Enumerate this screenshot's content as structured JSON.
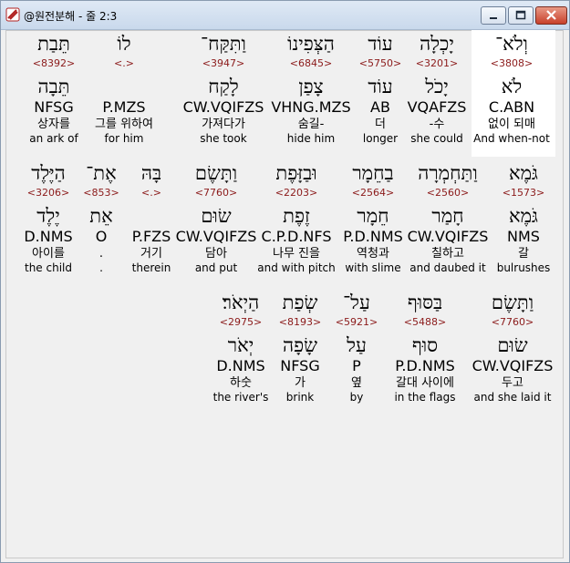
{
  "window": {
    "title": "@원전분해 - 줄 2:3"
  },
  "rows": [
    [
      {
        "heb": "וְלֹא־",
        "num": "<3808>",
        "lemma": "לֹא",
        "parse": "C.ABN",
        "kor": "없이 되매",
        "eng": "And when-not"
      },
      {
        "heb": "יָכְלָה",
        "num": "<3201>",
        "lemma": "יָכֹל",
        "parse": "VQAFZS",
        "kor": "-수",
        "eng": "she could"
      },
      {
        "heb": "עוֹד",
        "num": "<5750>",
        "lemma": "עוֹד",
        "parse": "AB",
        "kor": "더",
        "eng": "longer"
      },
      {
        "heb": "הַצְּפִינוֹ",
        "num": "<6845>",
        "lemma": "צָפַן",
        "parse": "VHNG.MZS",
        "kor": "숨길-",
        "eng": "hide him"
      },
      {
        "heb": "וַתִּקַּח־",
        "num": "<3947>",
        "lemma": "לָקַח",
        "parse": "CW.VQIFZS",
        "kor": "가져다가",
        "eng": "she took"
      },
      {
        "heb": "לוֹ",
        "num": "<.>",
        "lemma": "",
        "parse": "P.MZS",
        "kor": "그를 위하여",
        "eng": "for him"
      },
      {
        "heb": "תֵּבַת",
        "num": "<8392>",
        "lemma": "תֵּבָה",
        "parse": "NFSG",
        "kor": "상자를",
        "eng": "an ark of"
      }
    ],
    [
      {
        "heb": "גֹּמֶא",
        "num": "<1573>",
        "lemma": "גֹּמֶא",
        "parse": "NMS",
        "kor": "갈",
        "eng": "bulrushes"
      },
      {
        "heb": "וַתַּחְמְרָה",
        "num": "<2560>",
        "lemma": "חָמַר",
        "parse": "CW.VQIFZS",
        "kor": "칠하고",
        "eng": "and daubed it"
      },
      {
        "heb": "בַחֵמָר",
        "num": "<2564>",
        "lemma": "חֵמָר",
        "parse": "P.D.NMS",
        "kor": "역청과",
        "eng": "with slime"
      },
      {
        "heb": "וּבַזָּפֶת",
        "num": "<2203>",
        "lemma": "זֶפֶת",
        "parse": "C.P.D.NFS",
        "kor": "나무 진을",
        "eng": "and with pitch"
      },
      {
        "heb": "וַתָּשֶׂם",
        "num": "<7760>",
        "lemma": "שׂוּם",
        "parse": "CW.VQIFZS",
        "kor": "담아",
        "eng": "and put"
      },
      {
        "heb": "בָּהּ",
        "num": "<.>",
        "lemma": "",
        "parse": "P.FZS",
        "kor": "거기",
        "eng": "therein"
      },
      {
        "heb": "אֶת־",
        "num": "<853>",
        "lemma": "אֵת",
        "parse": "O",
        "kor": ".",
        "eng": "."
      },
      {
        "heb": "הַיֶּלֶד",
        "num": "<3206>",
        "lemma": "יֶלֶד",
        "parse": "D.NMS",
        "kor": "아이를",
        "eng": "the child"
      }
    ],
    [
      {
        "heb": "וַתָּשֶׂם",
        "num": "<7760>",
        "lemma": "שׂוּם",
        "parse": "CW.VQIFZS",
        "kor": "두고",
        "eng": "and she laid it"
      },
      {
        "heb": "בַּסּוּף",
        "num": "<5488>",
        "lemma": "סוּף",
        "parse": "P.D.NMS",
        "kor": "갈대 사이에",
        "eng": "in the flags"
      },
      {
        "heb": "עַל־",
        "num": "<5921>",
        "lemma": "עַל",
        "parse": "P",
        "kor": "옆",
        "eng": "by"
      },
      {
        "heb": "שְׂפַת",
        "num": "<8193>",
        "lemma": "שָׂפָה",
        "parse": "NFSG",
        "kor": "가",
        "eng": "brink"
      },
      {
        "heb": "הַיְאֹר׃",
        "num": "<2975>",
        "lemma": "יְאֹר",
        "parse": "D.NMS",
        "kor": "하숫",
        "eng": "the river's"
      }
    ]
  ],
  "colors": {
    "hebrew": "#000000",
    "strong": "#8b1a1a",
    "parse": "#1f2fc8",
    "selected_bg": "#ffffff"
  }
}
